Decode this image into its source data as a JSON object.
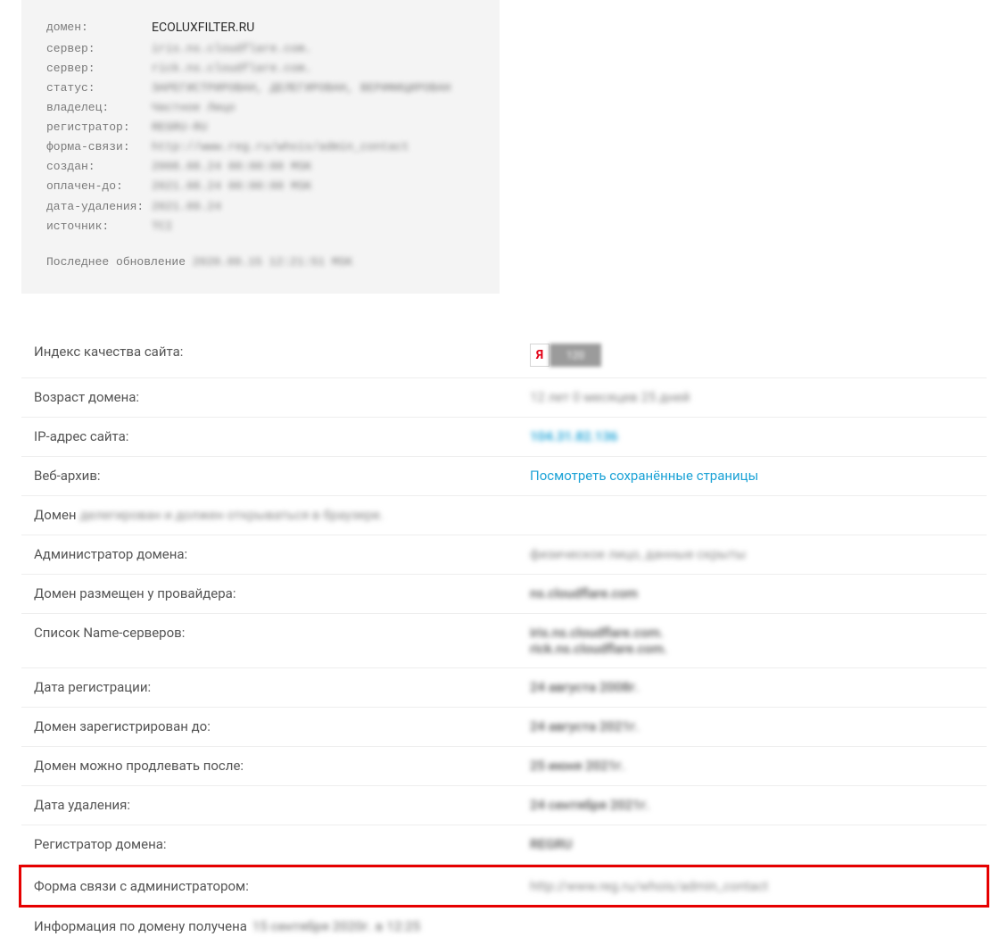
{
  "whois": {
    "rows": [
      {
        "key": "домен:",
        "val": "ECOLUXFILTER.RU",
        "domain": true
      },
      {
        "key": "сервер:",
        "val": "iris.ns.cloudflare.com.",
        "blur": true
      },
      {
        "key": "сервер:",
        "val": "rick.ns.cloudflare.com.",
        "blur": true
      },
      {
        "key": "статус:",
        "val": "ЗАРЕГИСТРИРОВАН, ДЕЛЕГИРОВАН, ВЕРИФИЦИРОВАН",
        "blur": true
      },
      {
        "key": "владелец:",
        "val": "Частное Лицо",
        "blur": true
      },
      {
        "key": "регистратор:",
        "val": "REGRU-RU",
        "blur": true
      },
      {
        "key": "форма-связи:",
        "val": "http://www.reg.ru/whois/admin_contact",
        "blur": true
      },
      {
        "key": "создан:",
        "val": "2008.08.24 00:00:00 MSK",
        "blur": true
      },
      {
        "key": "оплачен-до:",
        "val": "2021.08.24 00:00:00 MSK",
        "blur": true
      },
      {
        "key": "дата-удаления:",
        "val": "2021.09.24",
        "blur": true
      },
      {
        "key": "источник:",
        "val": "TCI",
        "blur": true
      }
    ],
    "footer_label": "Последнее обновление",
    "footer_val": "2020.09.15 12:21:51 MSK"
  },
  "info": {
    "quality_label": "Индекс качества сайта:",
    "badge_left": "Я",
    "badge_right": "120",
    "age_label": "Возраст домена:",
    "age_val": "12 лет 0 месяцев 25 дней",
    "ip_label": "IP-адрес сайта:",
    "ip_val": "104.31.82.136",
    "archive_label": "Веб-архив:",
    "archive_link": "Посмотреть сохранённые страницы",
    "delegation_label": "Домен",
    "delegation_val": "делегирован и должен открываться в браузере.",
    "admin_label": "Администратор домена:",
    "admin_val": "физическое лицо, данные скрыты",
    "provider_label": "Домен размещен у провайдера:",
    "provider_val": "ns.cloudflare.com",
    "ns_label": "Список Name-серверов:",
    "ns_val1": "iris.ns.cloudflare.com.",
    "ns_val2": "rick.ns.cloudflare.com.",
    "reg_date_label": "Дата регистрации:",
    "reg_date_val": "24 августа 2008г.",
    "reg_until_label": "Домен зарегистрирован до:",
    "reg_until_val": "24 августа 2021г.",
    "renew_after_label": "Домен можно продлевать после:",
    "renew_after_val": "25 июня 2021г.",
    "del_date_label": "Дата удаления:",
    "del_date_val": "24 сентября 2021г.",
    "registrar_label": "Регистратор домена:",
    "registrar_val": "REGRU",
    "contact_form_label": "Форма связи с администратором:",
    "contact_form_val": "http://www.reg.ru/whois/admin_contact",
    "received_label": "Информация по домену получена",
    "received_val": "15 сентября 2020г. в 12:25"
  }
}
